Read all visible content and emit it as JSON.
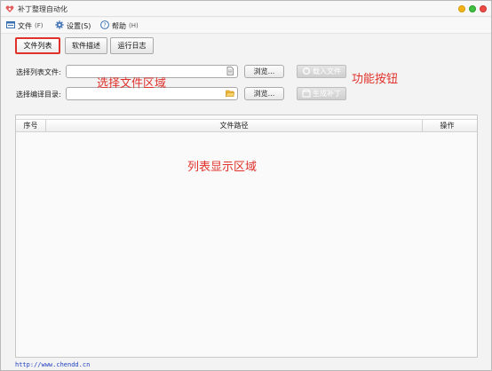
{
  "window": {
    "title": "补丁整理自动化",
    "controls": {
      "minimize_color": "#f2b316",
      "maximize_color": "#3fbf3f",
      "close_color": "#ec4a43"
    }
  },
  "menu": {
    "file": {
      "label": "文件",
      "shortcut": "(F)"
    },
    "settings": {
      "label": "设置(S)"
    },
    "help": {
      "label": "帮助",
      "shortcut": "(H)"
    }
  },
  "tabs": [
    {
      "label": "文件列表",
      "active": true
    },
    {
      "label": "软件描述",
      "active": false
    },
    {
      "label": "运行日志",
      "active": false
    }
  ],
  "form": {
    "list_file_label": "选择列表文件:",
    "list_file_value": "",
    "compile_dir_label": "选择编译目录:",
    "compile_dir_value": "",
    "browse_label": "浏览...",
    "load_file_label": "载入文件",
    "generate_patch_label": "生成补丁"
  },
  "annotations": {
    "select_area": "选择文件区域",
    "function_buttons": "功能按钮",
    "list_area": "列表显示区域",
    "color": "#e0322b"
  },
  "table": {
    "columns": [
      "序号",
      "文件路径",
      "操作"
    ],
    "rows": []
  },
  "status": {
    "url": "http://www.chendd.cn"
  },
  "icons": {
    "app": "app-logo-icon",
    "file_menu": "file-menu-icon",
    "settings_menu": "gear-icon",
    "help_menu": "help-icon",
    "list_file_picker": "document-icon",
    "dir_picker": "folder-open-icon",
    "load": "load-icon",
    "generate": "package-icon"
  }
}
